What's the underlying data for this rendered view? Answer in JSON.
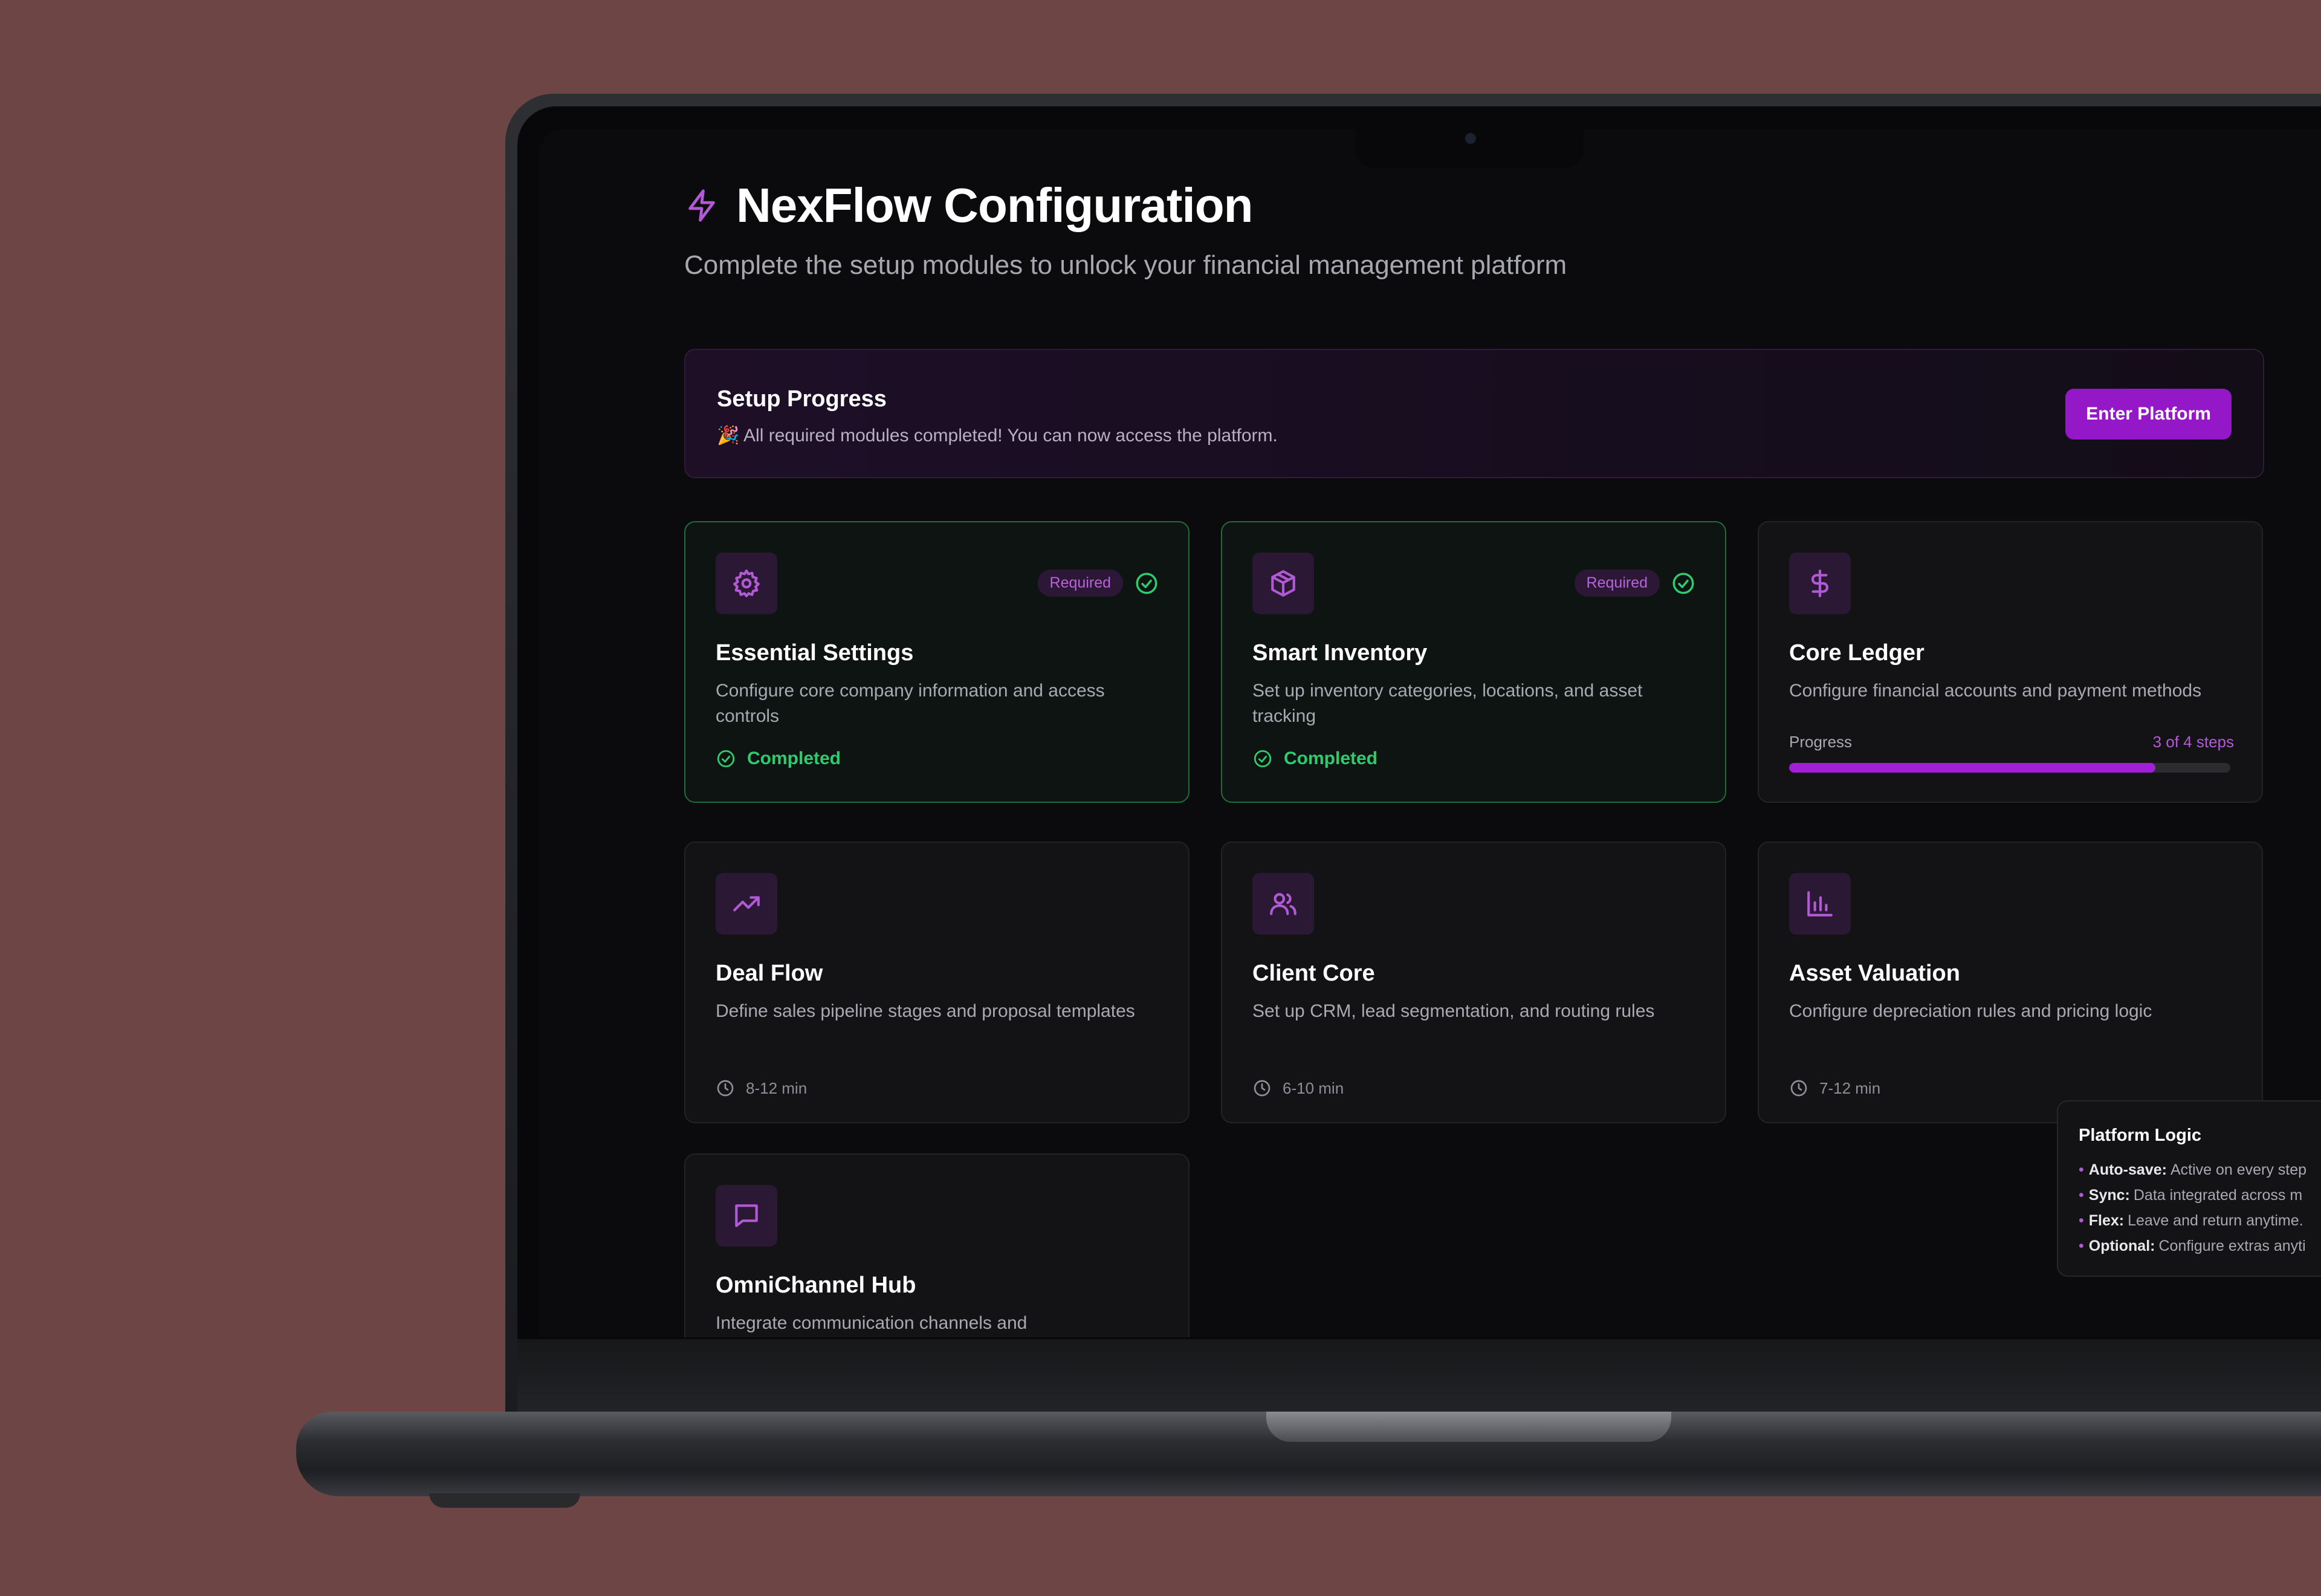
{
  "header": {
    "title": "NexFlow Configuration",
    "subtitle": "Complete the setup modules to unlock your financial management platform"
  },
  "progress": {
    "title": "Setup Progress",
    "message": "🎉 All required modules completed! You can now access the platform.",
    "enter_button": "Enter Platform"
  },
  "modules": [
    {
      "title": "Essential Settings",
      "description": "Configure core company information and access controls",
      "badge": "Required",
      "status": "Completed",
      "icon": "gear-icon"
    },
    {
      "title": "Smart Inventory",
      "description": "Set up inventory categories, locations, and asset tracking",
      "badge": "Required",
      "status": "Completed",
      "icon": "box-icon"
    },
    {
      "title": "Core Ledger",
      "description": "Configure financial accounts and payment methods",
      "progress_label": "Progress",
      "progress_steps": "3 of 4 steps",
      "progress_fraction": 0.83,
      "icon": "dollar-icon"
    },
    {
      "title": "Deal Flow",
      "description": "Define sales pipeline stages and proposal templates",
      "time": "8-12 min",
      "icon": "trending-up-icon"
    },
    {
      "title": "Client Core",
      "description": "Set up CRM, lead segmentation, and routing rules",
      "time": "6-10 min",
      "icon": "users-icon"
    },
    {
      "title": "Asset Valuation",
      "description": "Configure depreciation rules and pricing logic",
      "time": "7-12 min",
      "icon": "bar-chart-icon"
    },
    {
      "title": "OmniChannel Hub",
      "description": "Integrate communication channels and",
      "icon": "message-icon"
    }
  ],
  "platform_logic": {
    "title": "Platform Logic",
    "items": [
      {
        "label": "Auto-save:",
        "text": "Active on every step"
      },
      {
        "label": "Sync:",
        "text": "Data integrated across m"
      },
      {
        "label": "Flex:",
        "text": "Leave and return anytime."
      },
      {
        "label": "Optional:",
        "text": "Configure extras anyti"
      }
    ]
  },
  "colors": {
    "accent": "#a11fd6",
    "success": "#2ecc6f",
    "background": "#6d4545"
  }
}
